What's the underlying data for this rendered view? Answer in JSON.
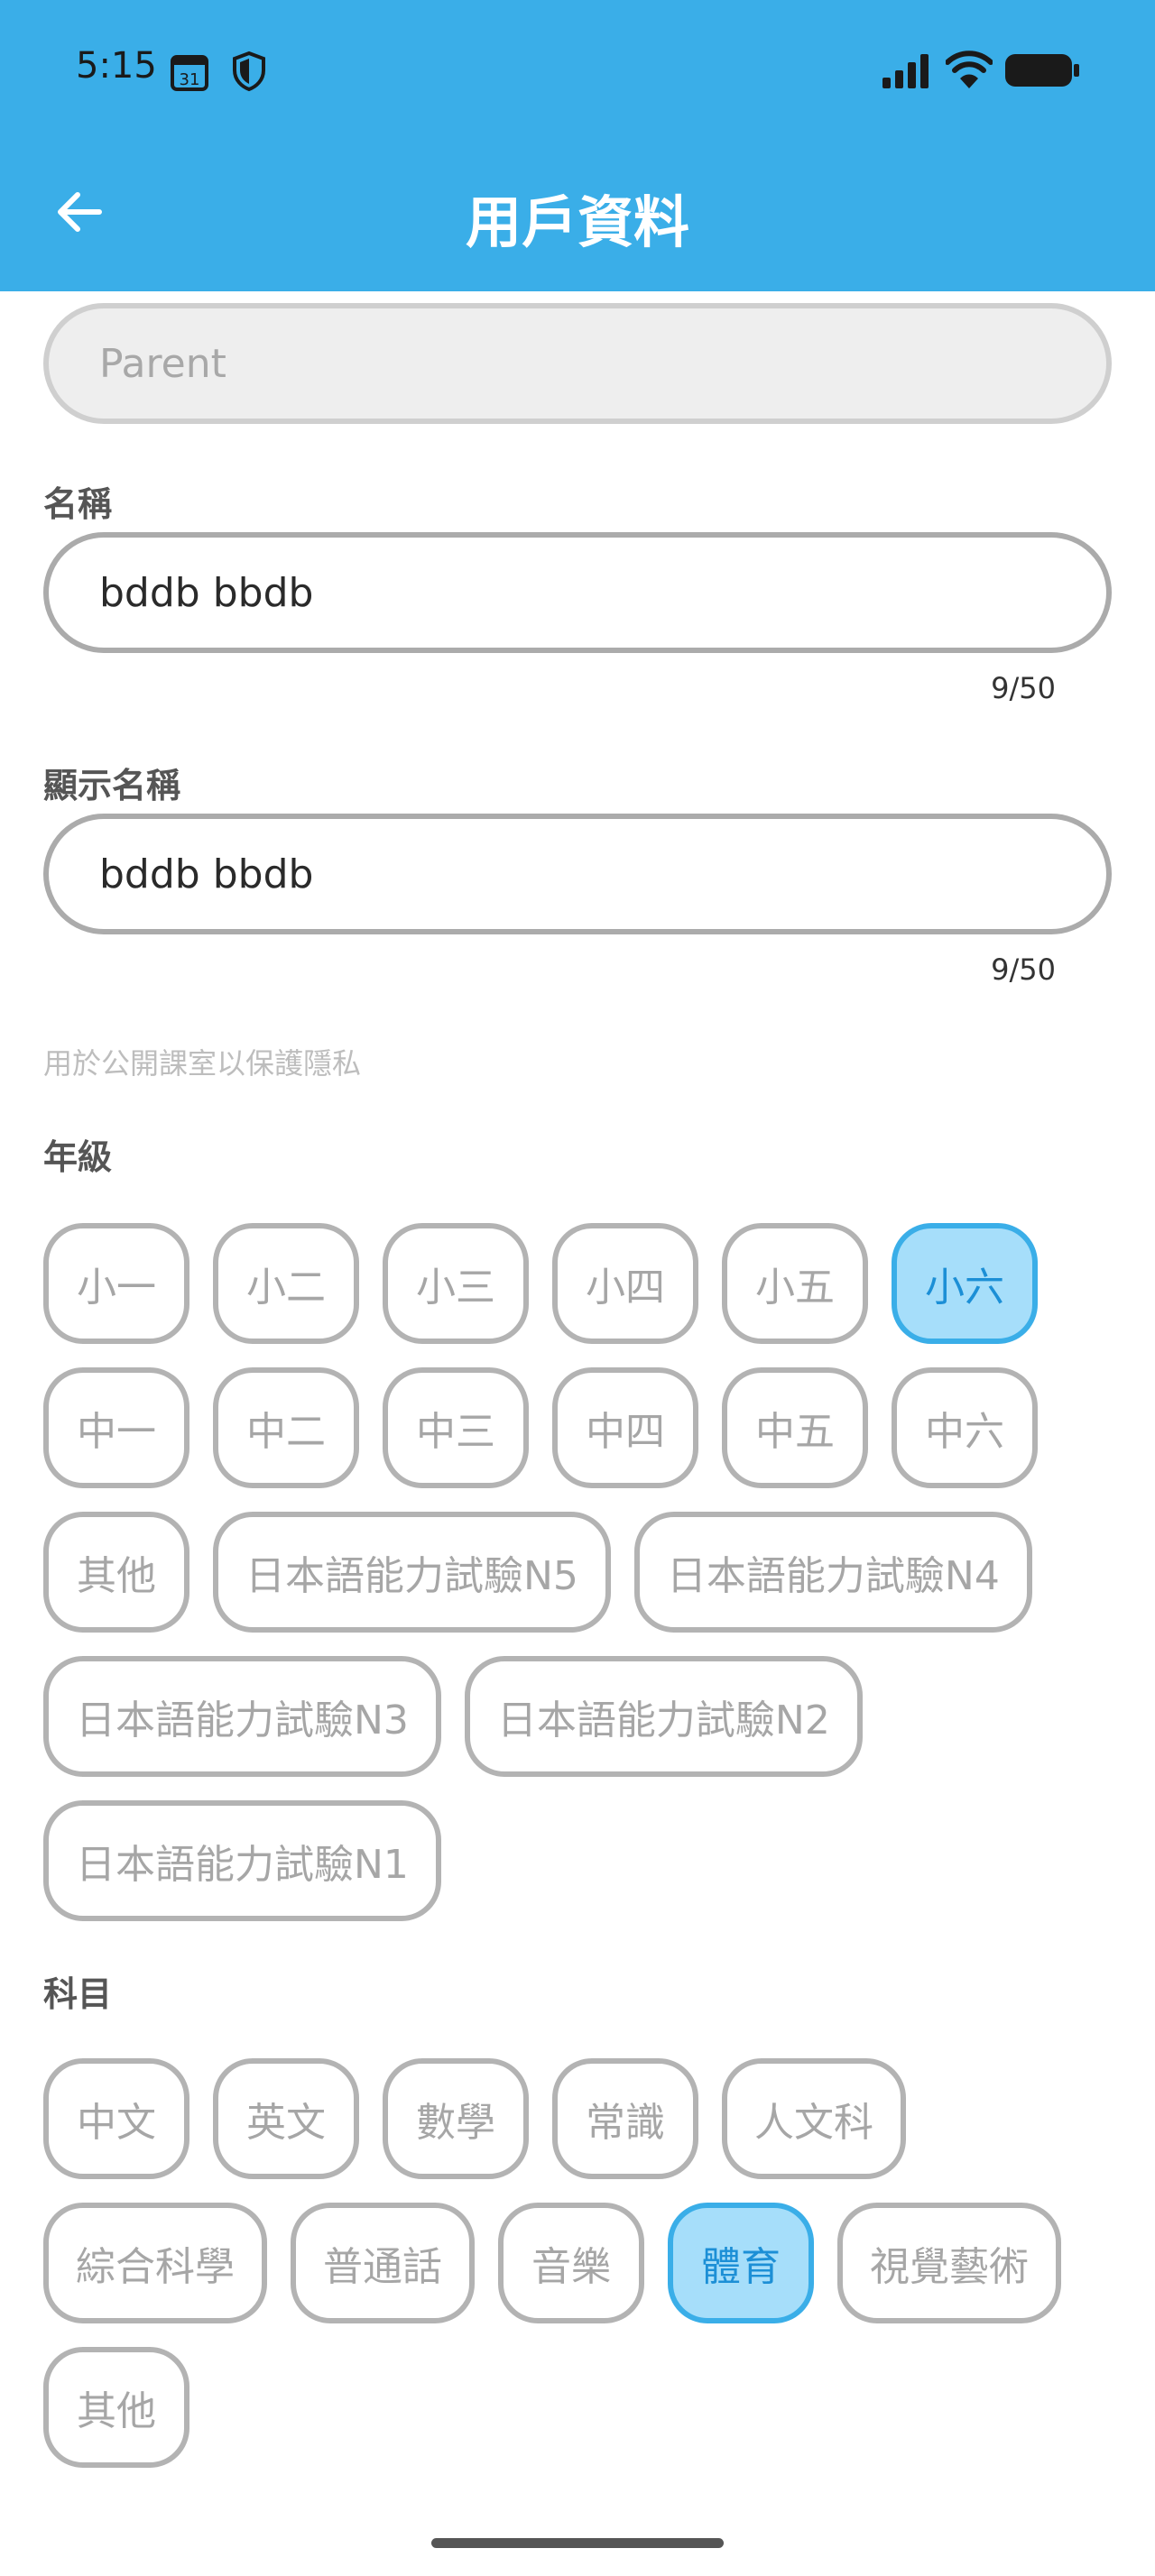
{
  "status_bar": {
    "time": "5:15",
    "calendar_day": "31",
    "icons": [
      "calendar-icon",
      "shield-icon",
      "signal-icon",
      "wifi-icon",
      "battery-icon"
    ]
  },
  "app_bar": {
    "title": "用戶資料",
    "back_icon": "arrow-left-icon",
    "background": "#3AAEE8"
  },
  "form": {
    "role_value": "Parent",
    "name": {
      "label": "名稱",
      "value": "bddb bbdb",
      "counter": "9/50"
    },
    "display_name": {
      "label": "顯示名稱",
      "value": "bddb bbdb",
      "counter": "9/50",
      "helper": "用於公開課室以保護隱私"
    },
    "grade": {
      "label": "年級",
      "options": [
        "小一",
        "小二",
        "小三",
        "小四",
        "小五",
        "小六",
        "中一",
        "中二",
        "中三",
        "中四",
        "中五",
        "中六",
        "其他",
        "日本語能力試驗N5",
        "日本語能力試驗N4",
        "日本語能力試驗N3",
        "日本語能力試驗N2",
        "日本語能力試驗N1"
      ],
      "selected": "小六"
    },
    "subject": {
      "label": "科目",
      "options": [
        "中文",
        "英文",
        "數學",
        "常識",
        "人文科",
        "綜合科學",
        "普通話",
        "音樂",
        "體育",
        "視覺藝術",
        "其他"
      ],
      "selected": "體育"
    }
  },
  "colors": {
    "accent": "#3AAEE8",
    "chip_selected_bg": "#A6DEFA",
    "chip_border": "#B3B3B3",
    "chip_text": "#A6A6A6"
  }
}
